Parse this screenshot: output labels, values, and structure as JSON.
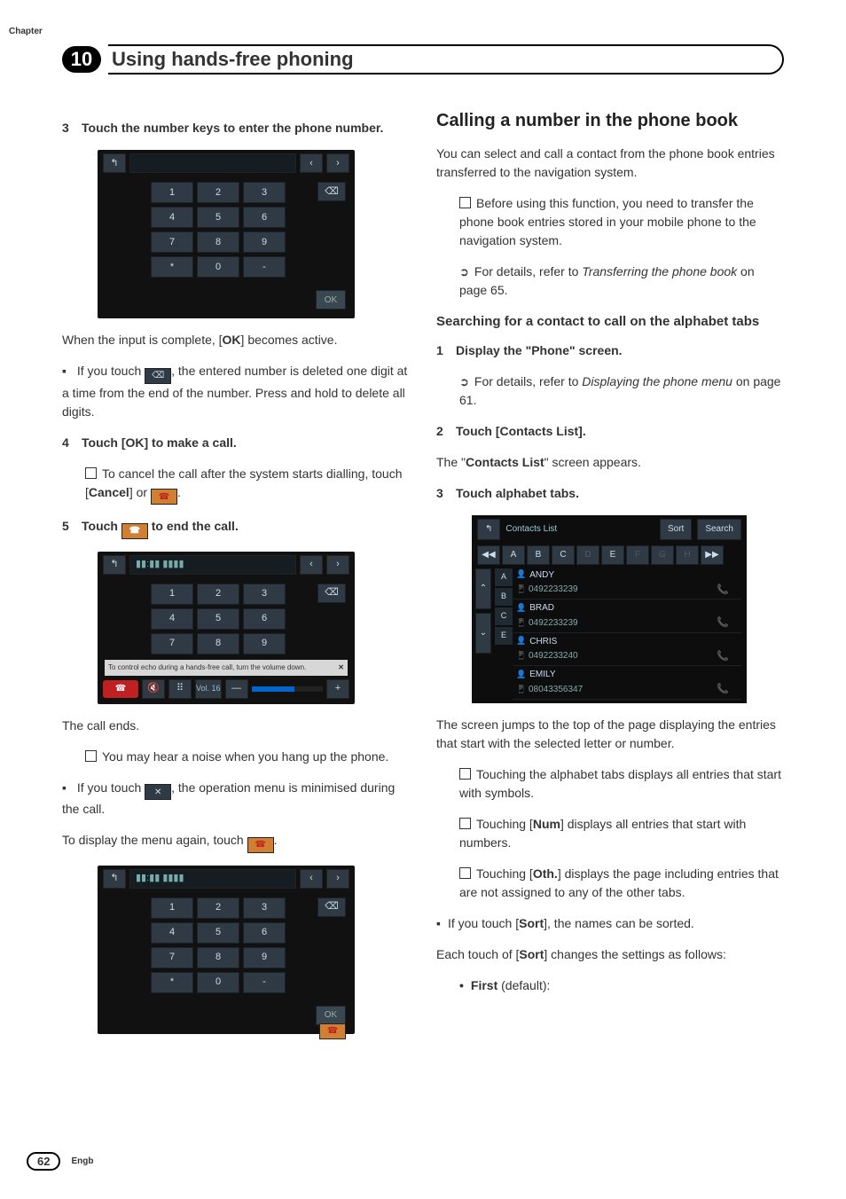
{
  "header": {
    "chapter_label": "Chapter",
    "chapter_number": "10",
    "title": "Using hands-free phoning"
  },
  "left": {
    "step3": {
      "num": "3",
      "text": "Touch the number keys to enter the phone number."
    },
    "keypad1": {
      "keys": [
        "1",
        "2",
        "3",
        "4",
        "5",
        "6",
        "7",
        "8",
        "9",
        "*",
        "0",
        "-"
      ],
      "ok": "OK",
      "del": "⌫"
    },
    "after_keypad1_a": "When the input is complete, [",
    "after_keypad1_ok": "OK",
    "after_keypad1_b": "] becomes active.",
    "bullet_del_a": "If you touch ",
    "bullet_del_icon": "⌫",
    "bullet_del_b": ", the entered number is deleted one digit at a time from the end of the number. Press and hold to delete all digits.",
    "step4": {
      "num": "4",
      "text": "Touch [OK] to make a call."
    },
    "step4_sub_a": "To cancel the call after the system starts dialling, touch [",
    "step4_sub_cancel": "Cancel",
    "step4_sub_b": "] or ",
    "step4_sub_c": ".",
    "step5": {
      "num": "5",
      "text_a": "Touch ",
      "text_b": " to end the call."
    },
    "keypad2": {
      "keys": [
        "1",
        "2",
        "3",
        "4",
        "5",
        "6",
        "7",
        "8",
        "9"
      ],
      "warn": "To control echo during a hands-free call, turn the volume down.",
      "warn_x": "✕",
      "vol_label": "Vol. 16",
      "minus": "—",
      "plus": "+",
      "del": "⌫"
    },
    "call_ends": "The call ends.",
    "noise_note": "You may hear a noise when you hang up the phone.",
    "min_a": "If you touch ",
    "min_icon": "✕",
    "min_b": ", the operation menu is minimised during the call.",
    "redisplay_a": "To display the menu again, touch ",
    "redisplay_b": ".",
    "keypad3": {
      "keys": [
        "1",
        "2",
        "3",
        "4",
        "5",
        "6",
        "7",
        "8",
        "9",
        "*",
        "0",
        "-"
      ],
      "ok": "OK",
      "del": "⌫"
    }
  },
  "right": {
    "h2": "Calling a number in the phone book",
    "intro": "You can select and call a contact from the phone book entries transferred to the navigation system.",
    "note_transfer": "Before using this function, you need to transfer the phone book entries stored in your mobile phone to the navigation system.",
    "ref_transfer_a": "For details, refer to ",
    "ref_transfer_i": "Transferring the phone book",
    "ref_transfer_b": " on page 65.",
    "h3": "Searching for a contact to call on the alphabet tabs",
    "step1": {
      "num": "1",
      "text": "Display the \"Phone\" screen."
    },
    "step1_ref_a": "For details, refer to ",
    "step1_ref_i": "Displaying the phone menu",
    "step1_ref_b": " on page 61.",
    "step2": {
      "num": "2",
      "text": "Touch [Contacts List]."
    },
    "step2_after_a": "The \"",
    "step2_after_b": "Contacts List",
    "step2_after_c": "\" screen appears.",
    "step3": {
      "num": "3",
      "text": "Touch alphabet tabs."
    },
    "contacts": {
      "title": "Contacts List",
      "sort": "Sort",
      "search": "Search",
      "tabs_nav_prev": "◀◀",
      "tabs": [
        "A",
        "B",
        "C",
        "D",
        "E",
        "F",
        "G",
        "H"
      ],
      "tabs_nav_next": "▶▶",
      "scroll_up": "⌃",
      "scroll_down": "⌄",
      "letters": [
        "A",
        "B",
        "C",
        "E"
      ],
      "items": [
        {
          "name": "ANDY",
          "phone": "0492233239"
        },
        {
          "name": "BRAD",
          "phone": "0492233239"
        },
        {
          "name": "CHRIS",
          "phone": "0492233240"
        },
        {
          "name": "EMILY",
          "phone": "08043356347"
        }
      ]
    },
    "jump_text": "The screen jumps to the top of the page displaying the entries that start with the selected letter or number.",
    "tabs_note": "Touching the alphabet tabs displays all entries that start with symbols.",
    "num_note_a": "Touching [",
    "num_note_b": "Num",
    "num_note_c": "] displays all entries that start with numbers.",
    "oth_note_a": "Touching [",
    "oth_note_b": "Oth.",
    "oth_note_c": "] displays the page including entries that are not assigned to any of the other tabs.",
    "sort_a": "If you touch [",
    "sort_b": "Sort",
    "sort_c": "], the names can be sorted.",
    "sort2_a": "Each touch of [",
    "sort2_b": "Sort",
    "sort2_c": "] changes the settings as follows:",
    "first_a": "First",
    "first_b": " (default):"
  },
  "footer": {
    "page": "62",
    "lang": "Engb"
  }
}
